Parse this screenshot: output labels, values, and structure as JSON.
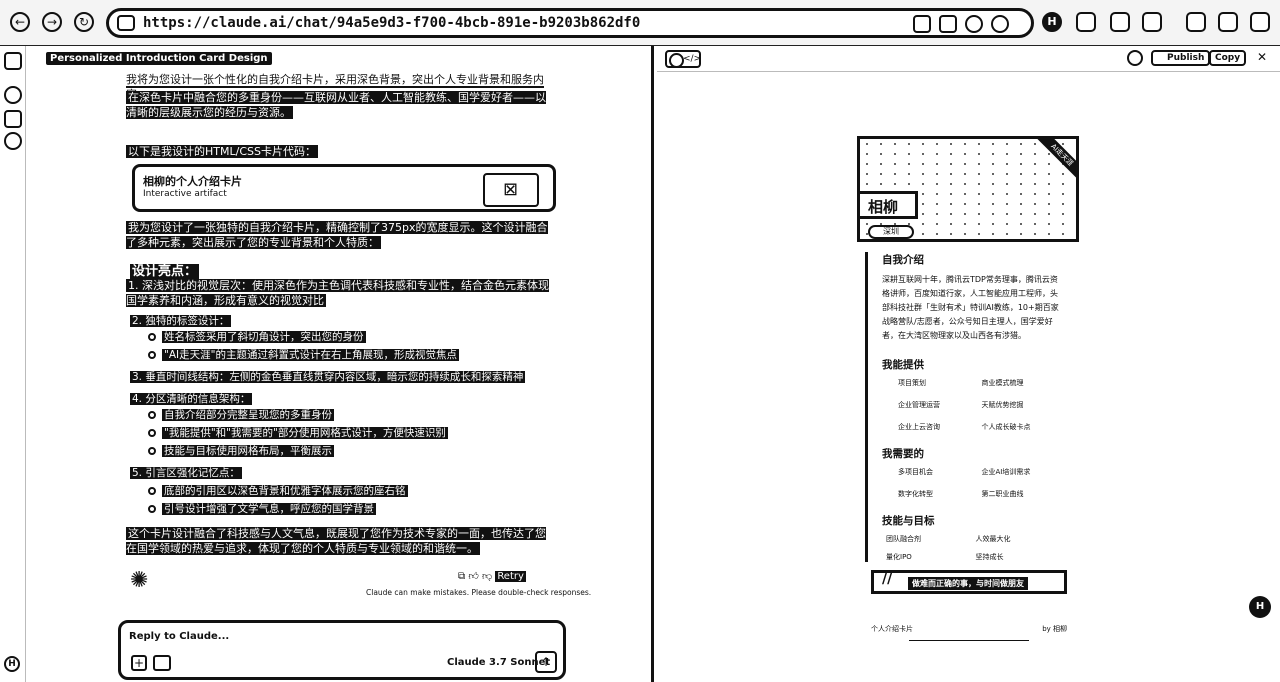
{
  "browser": {
    "url": "https://claude.ai/chat/94a5e9d3-f700-4bcb-891e-b9203b862df0",
    "profile_badge": "H"
  },
  "chat": {
    "title": "Personalized Introduction Card Design",
    "intro_paragraph": "我将为您设计一张个性化的自我介绍卡片，采用深色背景，突出个人专业背景和服务内容。",
    "role_paragraph": "在深色卡片中融合您的多重身份——互联网从业者、人工智能教练、国学爱好者——以清晰的层级展示您的经历与资源。",
    "artifact_intro": "以下是我设计的HTML/CSS卡片代码：",
    "artifact_title": "相柳的个人介绍卡片",
    "artifact_subtitle": "Interactive artifact",
    "after_artifact": "我为您设计了一张独特的自我介绍卡片，精确控制了375px的宽度显示。这个设计融合了多种元素，突出展示了您的专业背景和个人特质：",
    "design_heading": "设计亮点：",
    "points": [
      "1. 深浅对比的视觉层次：使用深色作为主色调代表科技感和专业性，结合金色元素体现国学素养和内涵，形成有意义的视觉对比",
      "2. 独特的标签设计：",
      "3. 垂直时间线结构：左侧的金色垂直线贯穿内容区域，暗示您的持续成长和探索精神",
      "4. 分区清晰的信息架构：",
      "5. 引言区强化记忆点："
    ],
    "sub_points_2": [
      "姓名标签采用了斜切角设计，突出您的身份",
      "\"AI走天涯\"的主题通过斜置式设计在右上角展现，形成视觉焦点"
    ],
    "sub_points_4": [
      "自我介绍部分完整呈现您的多重身份",
      "\"我能提供\"和\"我需要的\"部分使用网格式设计，方便快速识别",
      "技能与目标使用网格布局，平衡展示"
    ],
    "sub_points_5": [
      "底部的引用区以深色背景和优雅字体展示您的座右铭",
      "引号设计增强了文学气息，呼应您的国学背景"
    ],
    "closing_paragraph": "这个卡片设计融合了科技感与人文气息，既展现了您作为技术专家的一面，也传达了您在国学领域的热爱与追求，体现了您的个人特质与专业领域的和谐统一。",
    "actions": {
      "copy": "Copy",
      "retry": "Retry"
    },
    "disclaimer": "Claude can make mistakes. Please double-check responses.",
    "reply_placeholder": "Reply to Claude...",
    "model": "Claude 3.7 Sonnet"
  },
  "preview": {
    "code_tab": "</>",
    "publish": "Publish",
    "copy": "Copy",
    "card": {
      "ribbon": "AI走天涯",
      "name": "相柳",
      "location_tag": "深圳",
      "about_title": "自我介绍",
      "about_text": "深耕互联网十年，腾讯云TDP常务理事，腾讯云资格讲师，百度知道行家，人工智能应用工程师，头部科技社群「生财有术」特训AI教练，10+期百家战略营队/志愿者，公众号知日主理人，国学爱好者，在大湾区物理家以及山西各有涉猎。",
      "offer_title": "我能提供",
      "offer_items": [
        "项目策划",
        "商业模式梳理",
        "企业管理运营",
        "天赋优势挖掘",
        "企业上云咨询",
        "个人成长破卡点"
      ],
      "need_title": "我需要的",
      "need_items": [
        "多项目机会",
        "企业AI培训需求",
        "数字化转型",
        "第二职业曲线"
      ],
      "skills_title": "技能与目标",
      "skills_items": [
        "团队融合剂",
        "人效最大化",
        "量化IPO",
        "坚持成长"
      ],
      "quote": "做难而正确的事，与时间做朋友",
      "footer_left": "个人介绍卡片",
      "footer_right": "by 相柳"
    },
    "help_badge": "H"
  }
}
